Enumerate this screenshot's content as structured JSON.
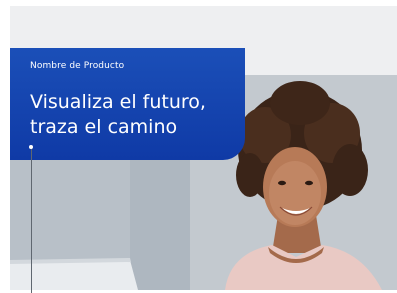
{
  "hero": {
    "product_label": "Nombre de Producto",
    "headline_line1": "Visualiza el futuro,",
    "headline_line2": "traza el camino"
  },
  "colors": {
    "card_blue": "#0f3aa6",
    "background_gray": "#eeeff1"
  }
}
